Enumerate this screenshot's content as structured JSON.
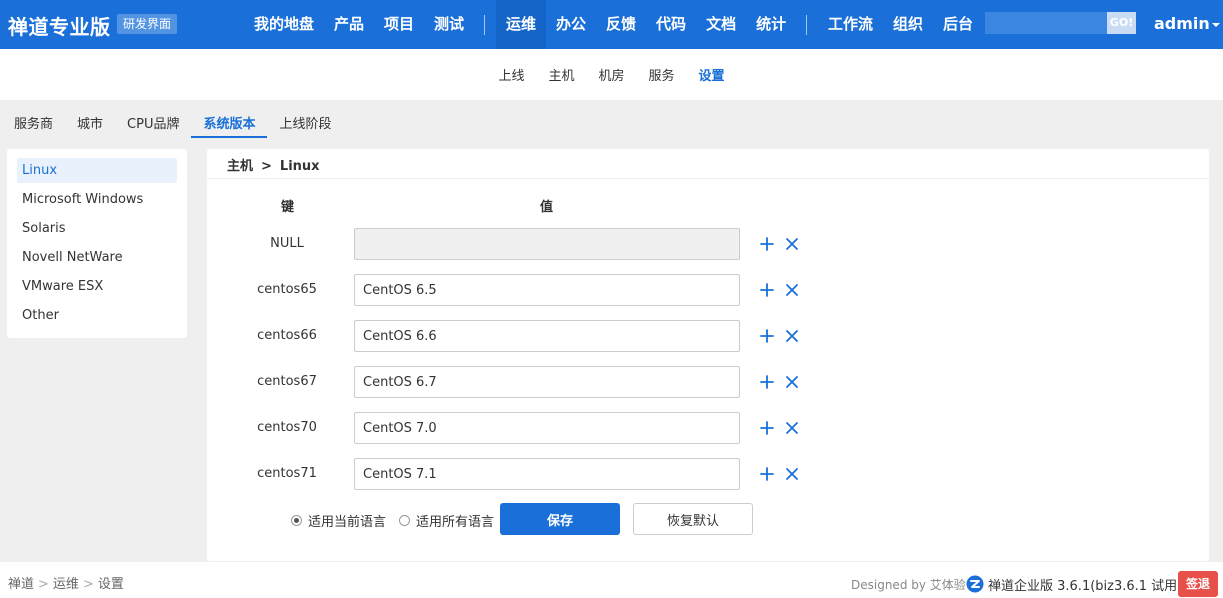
{
  "header": {
    "brand": "禅道专业版",
    "badge": "研发界面",
    "nav_left": [
      "我的地盘",
      "产品",
      "项目",
      "测试"
    ],
    "nav_mid": [
      "运维",
      "办公",
      "反馈",
      "代码",
      "文档",
      "统计"
    ],
    "nav_right": [
      "工作流",
      "组织",
      "后台"
    ],
    "active_nav": "运维",
    "search_placeholder": "",
    "search_button": "GO!",
    "user": "admin",
    "brand_color": "#1a70d8"
  },
  "subnav": {
    "items": [
      "上线",
      "主机",
      "机房",
      "服务",
      "设置"
    ],
    "active": "设置"
  },
  "tabs": {
    "items": [
      "服务商",
      "城市",
      "CPU品牌",
      "系统版本",
      "上线阶段"
    ],
    "active": "系统版本"
  },
  "sidebar": {
    "items": [
      "Linux",
      "Microsoft Windows",
      "Solaris",
      "Novell NetWare",
      "VMware ESX",
      "Other"
    ],
    "active": "Linux"
  },
  "main": {
    "breadcrumb_root": "主机",
    "breadcrumb_current": "Linux",
    "col_key": "键",
    "col_value": "值",
    "rows": [
      {
        "key": "NULL",
        "value": "",
        "disabled": true
      },
      {
        "key": "centos65",
        "value": "CentOS 6.5",
        "disabled": false
      },
      {
        "key": "centos66",
        "value": "CentOS 6.6",
        "disabled": false
      },
      {
        "key": "centos67",
        "value": "CentOS 6.7",
        "disabled": false
      },
      {
        "key": "centos70",
        "value": "CentOS 7.0",
        "disabled": false
      },
      {
        "key": "centos71",
        "value": "CentOS 7.1",
        "disabled": false
      }
    ],
    "radio_current": "适用当前语言",
    "radio_all": "适用所有语言",
    "radio_selected": "current",
    "save_button": "保存",
    "reset_button": "恢复默认"
  },
  "footer": {
    "crumbs": [
      "禅道",
      "运维",
      "设置"
    ],
    "designed_by": "Designed by 艾体验",
    "version": "禅道企业版 3.6.1(biz3.6.1 试用)",
    "signout": "签退",
    "signout_color": "#e8504a"
  }
}
